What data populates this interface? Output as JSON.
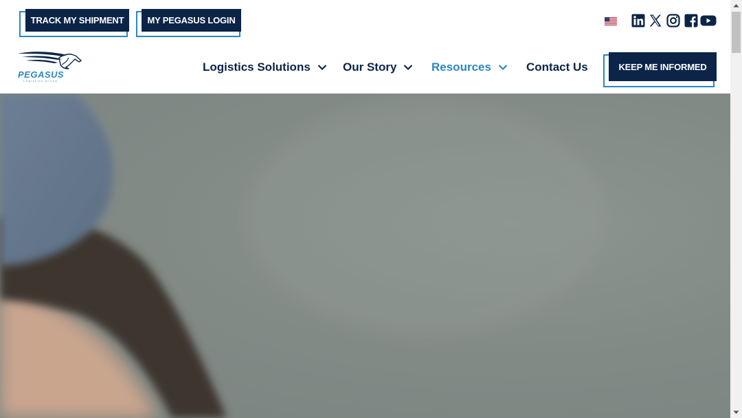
{
  "top_buttons": {
    "track_label": "TRACK MY SHIPMENT",
    "login_label": "MY PEGASUS LOGIN"
  },
  "header_icons": {
    "flag": "us-flag-icon",
    "social": [
      "linkedin-icon",
      "x-icon",
      "instagram-icon",
      "facebook-icon",
      "youtube-icon"
    ]
  },
  "logo": {
    "name": "PEGASUS",
    "tagline": "Logistics Group"
  },
  "nav": {
    "items": [
      {
        "label": "Logistics Solutions",
        "has_dropdown": true
      },
      {
        "label": "Our Story",
        "has_dropdown": true
      },
      {
        "label": "Resources",
        "has_dropdown": true,
        "active": true
      },
      {
        "label": "Contact Us",
        "has_dropdown": false
      }
    ],
    "cta_label": "KEEP ME INFORMED"
  },
  "colors": {
    "navy": "#0b2447",
    "accent_blue": "#2b86c4",
    "hero_gray": "#838b87"
  }
}
